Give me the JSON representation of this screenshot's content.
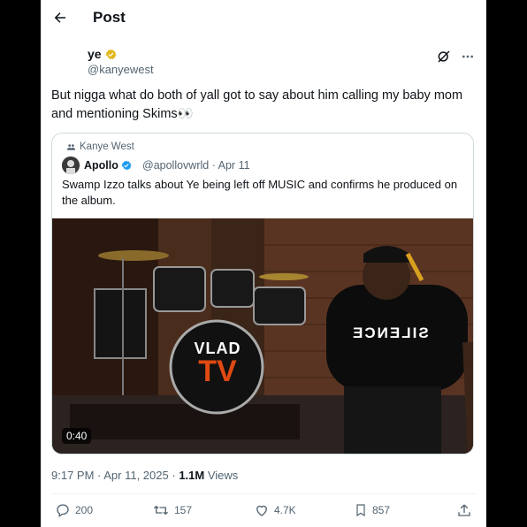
{
  "header": {
    "title": "Post"
  },
  "post": {
    "author_name": "ye",
    "author_handle": "@kanyewest",
    "text": "But nigga what do both of yall got to say about him calling my baby mom and mentioning Skims👀",
    "timestamp": "9:17 PM · Apr 11, 2025",
    "views_count": "1.1M",
    "views_label": "Views"
  },
  "quote": {
    "repost_by": "Kanye West",
    "author_name": "Apollo",
    "author_handle": "@apollovwrld · Apr 11",
    "text": "Swamp Izzo talks about Ye being left off MUSIC and confirms he produced on the album.",
    "video_duration": "0:40",
    "video_logo_top": "VLAD",
    "video_logo_bottom": "TV",
    "shirt_text": "SILENCE"
  },
  "actions": {
    "replies": "200",
    "reposts": "157",
    "likes": "4.7K",
    "bookmarks": "857"
  },
  "colors": {
    "verified_gold": "#e2b719",
    "verified_blue": "#1d9bf0",
    "text_secondary": "#536471"
  },
  "icons": [
    "back-arrow-icon",
    "verified-gold-icon",
    "grok-icon",
    "more-icon",
    "repost-icon",
    "verified-blue-icon",
    "reply-icon",
    "like-icon",
    "bookmark-icon",
    "share-icon"
  ]
}
